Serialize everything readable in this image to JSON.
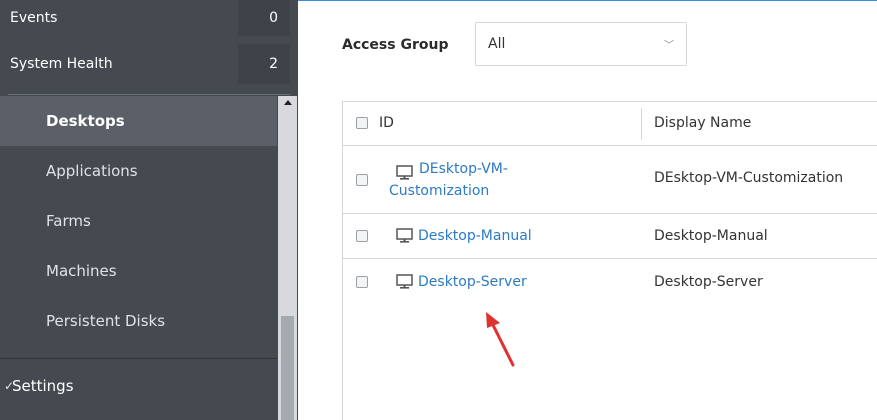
{
  "sidebar": {
    "events": {
      "label": "Events",
      "count": "0"
    },
    "system_health": {
      "label": "System Health",
      "count": "2"
    },
    "nav_items": [
      {
        "label": "Desktops",
        "active": true
      },
      {
        "label": "Applications"
      },
      {
        "label": "Farms"
      },
      {
        "label": "Machines"
      },
      {
        "label": "Persistent Disks"
      }
    ],
    "settings_label": "Settings"
  },
  "filter": {
    "label": "Access Group",
    "value": "All"
  },
  "table": {
    "columns": [
      "ID",
      "Display Name"
    ],
    "rows": [
      {
        "id": "DEsktop-VM-Customization",
        "display_name": "DEsktop-VM-Customization"
      },
      {
        "id": "Desktop-Manual",
        "display_name": "Desktop-Manual"
      },
      {
        "id": "Desktop-Server",
        "display_name": "Desktop-Server"
      }
    ]
  },
  "colors": {
    "sidebar_bg": "#454a51",
    "active_item_bg": "#5b6068",
    "link": "#2b7bc4",
    "annotation_arrow": "#e0312f"
  }
}
